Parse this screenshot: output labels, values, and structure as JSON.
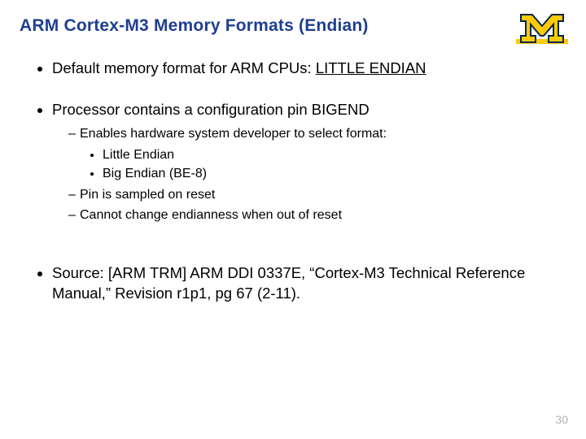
{
  "title": "ARM Cortex-M3 Memory Formats (Endian)",
  "bullets": {
    "b1_pre": "Default memory format for ARM CPUs: ",
    "b1_em": "LITTLE ENDIAN",
    "b2": "Processor contains a configuration pin BIGEND",
    "b2_1": "Enables hardware system developer to select format:",
    "b2_1_a": "Little Endian",
    "b2_1_b": "Big Endian (BE-8)",
    "b2_2": "Pin is sampled on reset",
    "b2_3": "Cannot change endianness when out of reset",
    "b3": "Source: [ARM TRM] ARM DDI 0337E, “Cortex-M3 Technical Reference Manual,” Revision r1p1, pg 67 (2-11)."
  },
  "page_number": "30",
  "logo_colors": {
    "maize": "#FFCB05",
    "blue": "#00274C"
  }
}
